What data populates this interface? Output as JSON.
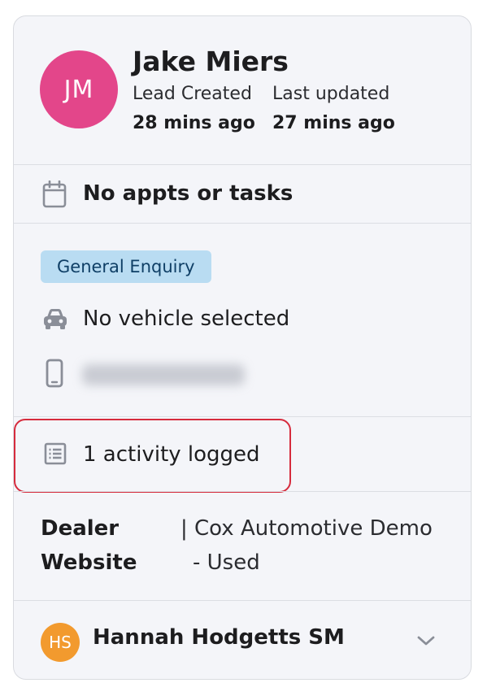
{
  "lead": {
    "initials": "JM",
    "name": "Jake Miers",
    "avatar_color": "#e3468a",
    "created_label": "Lead Created",
    "created_value": "28 mins ago",
    "updated_label": "Last updated",
    "updated_value": "27 mins ago"
  },
  "appointments": {
    "icon": "calendar-icon",
    "text": "No appts or tasks"
  },
  "enquiry": {
    "badge": "General Enquiry",
    "badge_bg": "#b9dcf2",
    "badge_fg": "#0f3f66",
    "vehicle_icon": "car-icon",
    "vehicle_text": "No vehicle selected",
    "phone_icon": "mobile-phone-icon"
  },
  "activity": {
    "icon": "list-icon",
    "text": "1 activity logged",
    "highlight_color": "#d62b3d"
  },
  "source": {
    "label_line1": "Dealer",
    "label_line2": "Website",
    "value_line1": "| Cox Automotive Demo",
    "value_line2": "- Used"
  },
  "owner": {
    "initials": "HS",
    "name": "Hannah Hodgetts SM",
    "avatar_color": "#f29a2e",
    "toggle_icon": "chevron-down-icon"
  }
}
